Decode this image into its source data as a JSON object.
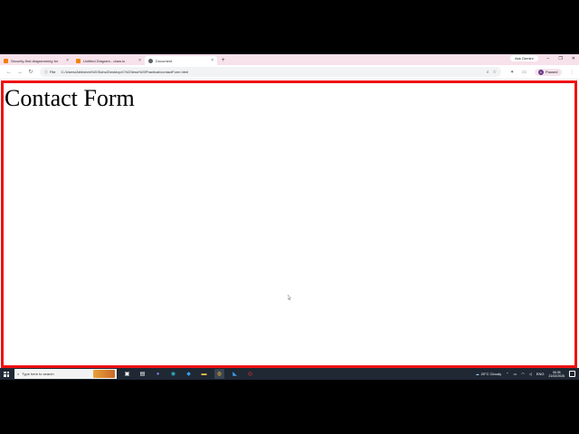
{
  "browser": {
    "tabs": [
      {
        "label": "Security-first diagramming for",
        "favicon_color": "#f57c00",
        "active": false
      },
      {
        "label": "Untitled Diagram - draw.io",
        "favicon_color": "#f08705",
        "active": false
      },
      {
        "label": "Document",
        "favicon_color": "#5f6368",
        "active": true
      }
    ],
    "new_tab": "+",
    "ask_gemini": "Ask Gemini",
    "address": {
      "chip": "File",
      "url": "C:/Users/Abhishek%20Sahu/Desktop/C%20less%20Practical/contactForm.html"
    },
    "profile": {
      "initial": "A",
      "label": "Paused"
    }
  },
  "page": {
    "heading": "Contact Form"
  },
  "taskbar": {
    "search_placeholder": "Type here to search",
    "weather": "20°C  Cloudy",
    "language": "ENG",
    "time": "06:35",
    "date": "21/02/2026"
  },
  "colors": {
    "page_border": "#ee1111",
    "tabstrip": "#f7e1ea",
    "taskbar": "#1f2833"
  }
}
